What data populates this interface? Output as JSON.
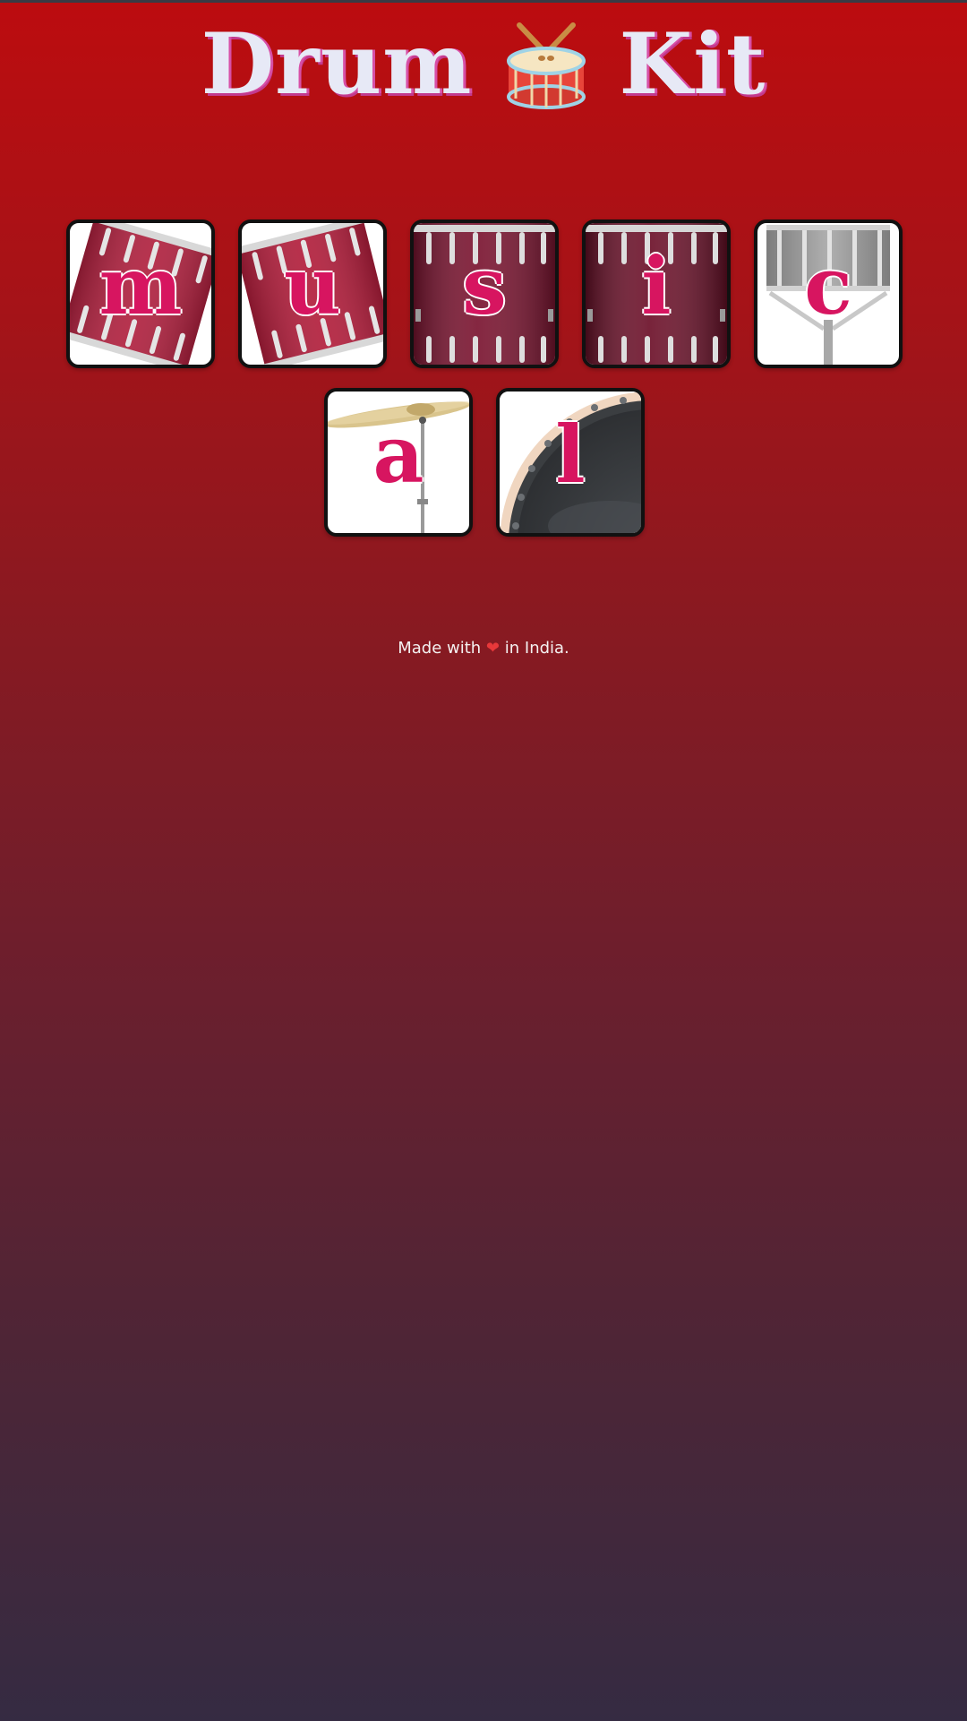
{
  "header": {
    "title_left": "Drum",
    "title_right": "Kit",
    "title_icon": "drum-icon"
  },
  "keys": [
    {
      "letter": "m",
      "instrument": "tom-1"
    },
    {
      "letter": "u",
      "instrument": "tom-2"
    },
    {
      "letter": "s",
      "instrument": "tom-3"
    },
    {
      "letter": "i",
      "instrument": "tom-4"
    },
    {
      "letter": "c",
      "instrument": "snare"
    },
    {
      "letter": "a",
      "instrument": "crash"
    },
    {
      "letter": "l",
      "instrument": "kick-bass"
    }
  ],
  "footer": {
    "prefix": "Made with",
    "heart": "❤",
    "suffix": "in India."
  },
  "colors": {
    "background_top": "#bc0c0f",
    "background_bottom": "#352b42",
    "title_text": "#e7e9f6",
    "title_shadow": "#d74fa6",
    "key_letter": "#d71560",
    "key_border": "#111111"
  }
}
